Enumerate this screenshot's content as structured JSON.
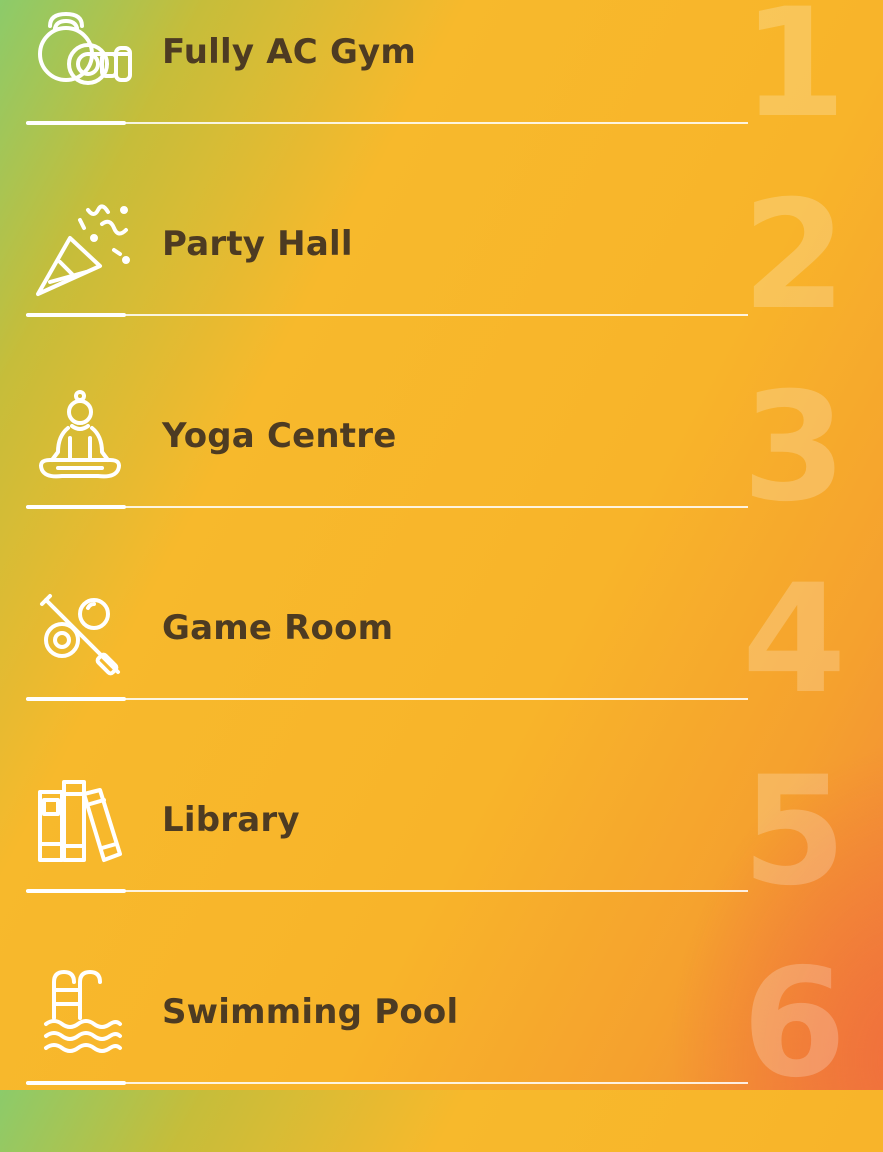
{
  "amenities": [
    {
      "number": "1",
      "label": "Fully AC Gym",
      "icon": "kettlebell-dumbbell-icon"
    },
    {
      "number": "2",
      "label": "Party Hall",
      "icon": "party-popper-icon"
    },
    {
      "number": "3",
      "label": "Yoga Centre",
      "icon": "yoga-meditation-icon"
    },
    {
      "number": "4",
      "label": "Game Room",
      "icon": "billiards-icon"
    },
    {
      "number": "5",
      "label": "Library",
      "icon": "books-icon"
    },
    {
      "number": "6",
      "label": "Swimming Pool",
      "icon": "pool-ladder-icon"
    }
  ],
  "colors": {
    "text": "#4d3b22",
    "line": "#ffffff",
    "gradient_start": "#8ccb6a",
    "gradient_mid": "#f7b92c",
    "gradient_end": "#f1853a"
  }
}
